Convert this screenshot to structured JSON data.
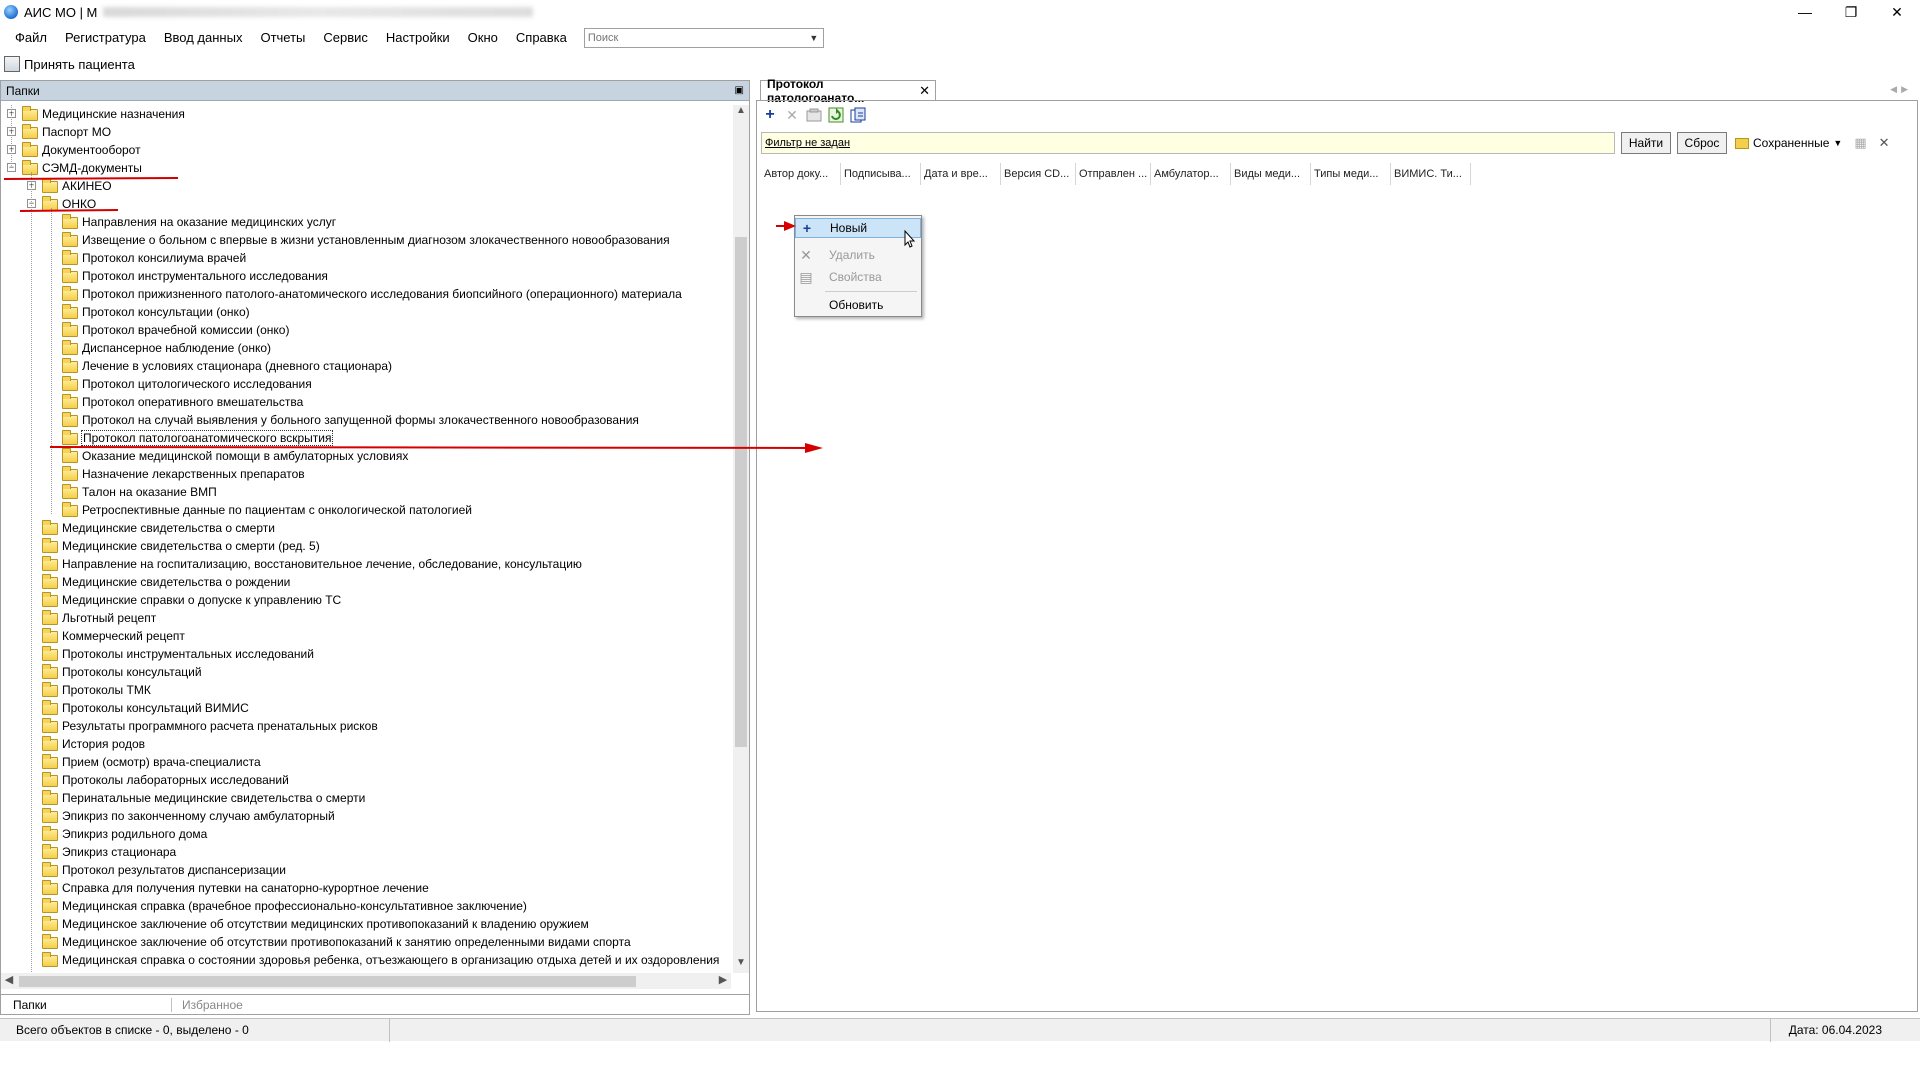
{
  "window": {
    "title": "АИС МО | М"
  },
  "menubar": {
    "items": [
      "Файл",
      "Регистратура",
      "Ввод данных",
      "Отчеты",
      "Сервис",
      "Настройки",
      "Окно",
      "Справка"
    ],
    "search_placeholder": "Поиск"
  },
  "toolbar": {
    "accept_patient": "Принять пациента"
  },
  "left_panel": {
    "header": "Папки",
    "tabs": [
      "Папки",
      "Избранное"
    ],
    "tree": [
      {
        "label": "Медицинские назначения",
        "level": 0,
        "expander": "+"
      },
      {
        "label": "Паспорт МО",
        "level": 0,
        "expander": "+"
      },
      {
        "label": "Документооборот",
        "level": 0,
        "expander": "+"
      },
      {
        "label": "СЭМД-документы",
        "level": 0,
        "expander": "−"
      },
      {
        "label": "АКИНЕО",
        "level": 1,
        "expander": "+"
      },
      {
        "label": "ОНКО",
        "level": 1,
        "expander": "−"
      },
      {
        "label": "Направления на оказание медицинских услуг",
        "level": 2
      },
      {
        "label": "Извещение о больном с впервые в жизни установленным диагнозом злокачественного новообразования",
        "level": 2
      },
      {
        "label": "Протокол консилиума врачей",
        "level": 2
      },
      {
        "label": "Протокол инструментального исследования",
        "level": 2
      },
      {
        "label": "Протокол прижизненного патолого-анатомического исследования биопсийного (операционного) материала",
        "level": 2
      },
      {
        "label": "Протокол консультации (онко)",
        "level": 2
      },
      {
        "label": "Протокол врачебной комиссии (онко)",
        "level": 2
      },
      {
        "label": "Диспансерное наблюдение (онко)",
        "level": 2
      },
      {
        "label": "Лечение в условиях стационара (дневного стационара)",
        "level": 2
      },
      {
        "label": "Протокол цитологического исследования",
        "level": 2
      },
      {
        "label": "Протокол оперативного вмешательства",
        "level": 2
      },
      {
        "label": "Протокол на случай выявления у больного запущенной формы злокачественного новообразования",
        "level": 2
      },
      {
        "label": "Протокол патологоанатомического вскрытия",
        "level": 2,
        "selected": true
      },
      {
        "label": "Оказание медицинской помощи в амбулаторных условиях",
        "level": 2
      },
      {
        "label": "Назначение лекарственных препаратов",
        "level": 2
      },
      {
        "label": "Талон на оказание ВМП",
        "level": 2
      },
      {
        "label": "Ретроспективные данные по пациентам с онкологической патологией",
        "level": 2
      },
      {
        "label": "Медицинские свидетельства о смерти",
        "level": 1
      },
      {
        "label": "Медицинские свидетельства о смерти (ред. 5)",
        "level": 1
      },
      {
        "label": "Направление на госпитализацию, восстановительное лечение, обследование, консультацию",
        "level": 1
      },
      {
        "label": "Медицинские свидетельства о рождении",
        "level": 1
      },
      {
        "label": "Медицинские справки о допуске к управлению ТС",
        "level": 1
      },
      {
        "label": "Льготный рецепт",
        "level": 1
      },
      {
        "label": "Коммерческий рецепт",
        "level": 1
      },
      {
        "label": "Протоколы инструментальных исследований",
        "level": 1
      },
      {
        "label": "Протоколы консультаций",
        "level": 1
      },
      {
        "label": "Протоколы ТМК",
        "level": 1
      },
      {
        "label": "Протоколы консультаций ВИМИС",
        "level": 1
      },
      {
        "label": "Результаты программного расчета пренатальных рисков",
        "level": 1
      },
      {
        "label": "История родов",
        "level": 1
      },
      {
        "label": "Прием (осмотр) врача-специалиста",
        "level": 1
      },
      {
        "label": "Протоколы лабораторных исследований",
        "level": 1
      },
      {
        "label": "Перинатальные медицинские свидетельства о смерти",
        "level": 1
      },
      {
        "label": "Эпикриз по законченному случаю амбулаторный",
        "level": 1
      },
      {
        "label": "Эпикриз родильного дома",
        "level": 1
      },
      {
        "label": "Эпикриз стационара",
        "level": 1
      },
      {
        "label": "Протокол результатов диспансеризации",
        "level": 1
      },
      {
        "label": "Справка для получения путевки на санаторно-курортное лечение",
        "level": 1
      },
      {
        "label": "Медицинская справка (врачебное профессионально-консультативное заключение)",
        "level": 1
      },
      {
        "label": "Медицинское заключение об отсутствии медицинских противопоказаний к владению оружием",
        "level": 1
      },
      {
        "label": "Медицинское заключение об отсутствии противопоказаний к занятию определенными видами спорта",
        "level": 1
      },
      {
        "label": "Медицинская справка о состоянии здоровья ребенка, отъезжающего в организацию отдыха детей и их оздоровления",
        "level": 1
      }
    ]
  },
  "right_panel": {
    "tab_title": "Протокол патологоанато...",
    "filter_text": "Фильтр не задан",
    "find_button": "Найти",
    "reset_button": "Сброс",
    "saved_label": "Сохраненные",
    "columns": [
      "Автор доку...",
      "Подписыва...",
      "Дата и вре...",
      "Версия CD...",
      "Отправлен ...",
      "Амбулатор...",
      "Виды меди...",
      "Типы меди...",
      "ВИМИС. Ти..."
    ]
  },
  "context_menu": {
    "items": [
      {
        "label": "Новый",
        "icon": "plus-icon",
        "state": "highlighted"
      },
      {
        "label": "Удалить",
        "icon": "delete-icon",
        "state": "disabled"
      },
      {
        "label": "Свойства",
        "icon": "properties-icon",
        "state": "disabled"
      },
      {
        "label": "Обновить",
        "icon": "",
        "state": "normal"
      }
    ]
  },
  "statusbar": {
    "objects": "Всего объектов в списке - 0, выделено - 0",
    "date": "Дата: 06.04.2023"
  },
  "colors": {
    "annotation": "#d40000",
    "selection": "#cce4f7",
    "filter_bg": "#ffffe1",
    "panel_header": "#c7d4e0"
  }
}
